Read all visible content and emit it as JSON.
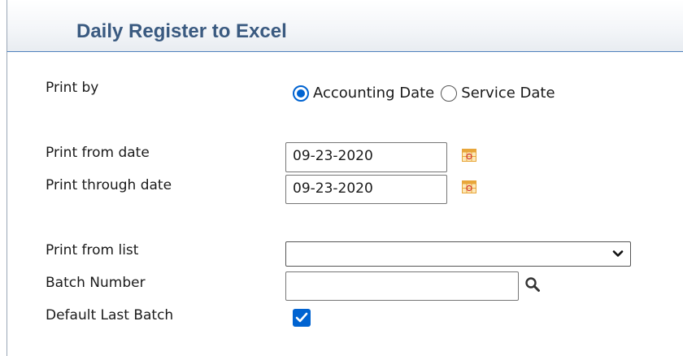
{
  "header": {
    "title": "Daily Register to Excel"
  },
  "form": {
    "print_by": {
      "label": "Print by",
      "options": [
        {
          "label": "Accounting Date",
          "selected": true
        },
        {
          "label": "Service Date",
          "selected": false
        }
      ]
    },
    "from_date": {
      "label": "Print from date",
      "value": "09-23-2020",
      "icon": "calendar-icon"
    },
    "through_date": {
      "label": "Print through date",
      "value": "09-23-2020",
      "icon": "calendar-icon"
    },
    "print_from_list": {
      "label": "Print from list",
      "value": "",
      "icon": "chevron-down-icon"
    },
    "batch_number": {
      "label": "Batch Number",
      "value": "",
      "icon": "search-icon"
    },
    "default_last_batch": {
      "label": "Default Last Batch",
      "checked": true
    }
  },
  "colors": {
    "title": "#3a5a80",
    "accent": "#0063d1",
    "header_border": "#4f81bd",
    "calendar_icon": "#e8a63a"
  }
}
